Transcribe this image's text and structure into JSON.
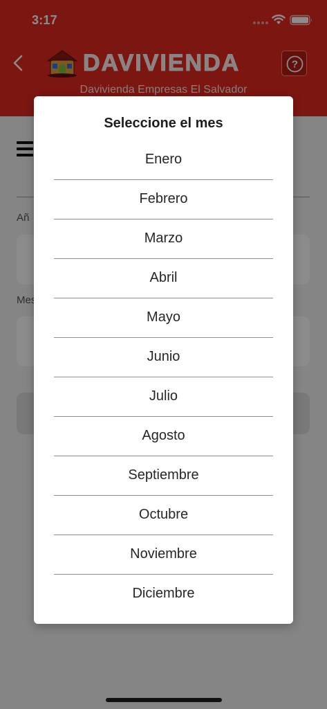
{
  "status_bar": {
    "time": "3:17"
  },
  "header": {
    "brand_name": "DAVIVIENDA",
    "subtitle": "Davivienda Empresas El Salvador",
    "help_symbol": "?",
    "colors": {
      "brand_red": "#e2281f"
    },
    "icons": [
      "back-chevron-icon",
      "davivienda-house-logo",
      "help-icon"
    ]
  },
  "form": {
    "year_label": "Añ",
    "month_label": "Mes"
  },
  "modal": {
    "title": "Seleccione el mes",
    "months": [
      "Enero",
      "Febrero",
      "Marzo",
      "Abril",
      "Mayo",
      "Junio",
      "Julio",
      "Agosto",
      "Septiembre",
      "Octubre",
      "Noviembre",
      "Diciembre"
    ]
  }
}
